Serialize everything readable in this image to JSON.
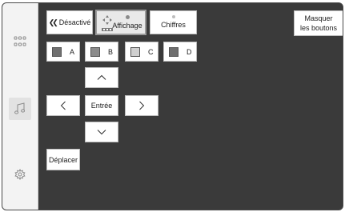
{
  "colors": {
    "panel_bg": "#3a3a3a",
    "sidebar_bg": "#f3f3f3",
    "button_bg": "#ffffff",
    "swatch_dark": "#707070",
    "swatch_mid": "#8c8c8c",
    "swatch_light": "#cfcfcf"
  },
  "sidebar": {
    "icons": [
      "apps-grid-icon",
      "music-note-icon",
      "settings-gear-icon"
    ],
    "active": "music-note-icon"
  },
  "toolbar": {
    "back_chevrons": "❮❮",
    "off_label": "Désactivé",
    "display_label": "Affichage",
    "digits_label": "Chiffres",
    "hide_buttons_line1": "Masquer",
    "hide_buttons_line2": "les boutons"
  },
  "letters": [
    {
      "label": "A",
      "swatch": "#707070"
    },
    {
      "label": "B",
      "swatch": "#8c8c8c"
    },
    {
      "label": "C",
      "swatch": "#cfcfcf"
    },
    {
      "label": "D",
      "swatch": "#6e6e6e"
    }
  ],
  "dpad": {
    "up_glyph": "︿",
    "down_glyph": "﹀",
    "left_glyph": "〈",
    "right_glyph": "〉",
    "enter_label": "Entrée"
  },
  "move_label": "Déplacer"
}
